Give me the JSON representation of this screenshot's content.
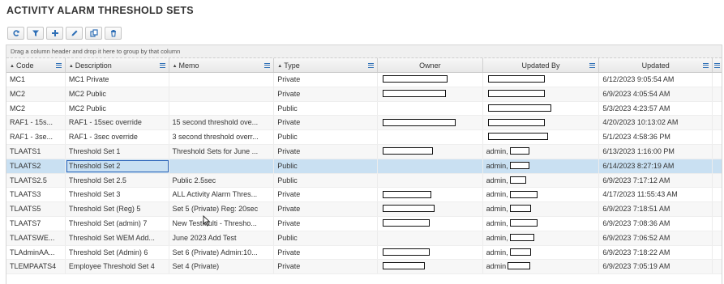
{
  "page": {
    "title": "ACTIVITY ALARM THRESHOLD SETS"
  },
  "toolbar": {
    "buttons": [
      {
        "name": "refresh-icon"
      },
      {
        "name": "filter-icon"
      },
      {
        "name": "add-icon"
      },
      {
        "name": "edit-icon"
      },
      {
        "name": "copy-icon"
      },
      {
        "name": "delete-icon"
      }
    ]
  },
  "grid": {
    "group_hint": "Drag a column header and drop it here to group by that column",
    "columns": [
      "Code",
      "Description",
      "Memo",
      "Type",
      "Owner",
      "Updated By",
      "Updated"
    ],
    "rows": [
      {
        "code": "MC1",
        "description": "MC1 Private",
        "memo": "",
        "type": "Private",
        "updated_by": "",
        "updated": "6/12/2023 9:05:54 AM"
      },
      {
        "code": "MC2",
        "description": "MC2 Public",
        "memo": "",
        "type": "Private",
        "updated_by": "",
        "updated": "6/9/2023 4:05:54 AM"
      },
      {
        "code": "MC2",
        "description": "MC2 Public",
        "memo": "",
        "type": "Public",
        "updated_by": "",
        "updated": "5/3/2023 4:23:57 AM"
      },
      {
        "code": "RAF1 - 15s...",
        "description": "RAF1 - 15sec override",
        "memo": "15 second threshold ove...",
        "type": "Private",
        "updated_by": "",
        "updated": "4/20/2023 10:13:02 AM"
      },
      {
        "code": "RAF1 - 3se...",
        "description": "RAF1 - 3sec override",
        "memo": "3 second threshold overr...",
        "type": "Public",
        "updated_by": "",
        "updated": "5/1/2023 4:58:36 PM"
      },
      {
        "code": "TLAATS1",
        "description": "Threshold Set 1",
        "memo": "Threshold Sets for June ...",
        "type": "Private",
        "updated_by": "admin,",
        "updated": "6/13/2023 1:16:00 PM"
      },
      {
        "code": "TLAATS2",
        "description": "Threshold Set 2",
        "memo": "",
        "type": "Public",
        "updated_by": "admin,",
        "updated": "6/14/2023 8:27:19 AM"
      },
      {
        "code": "TLAATS2.5",
        "description": "Threshold Set 2.5",
        "memo": "Public 2.5sec",
        "type": "Public",
        "updated_by": "admin,",
        "updated": "6/9/2023 7:17:12 AM"
      },
      {
        "code": "TLAATS3",
        "description": "Threshold Set 3",
        "memo": "ALL Activity Alarm Thres...",
        "type": "Private",
        "updated_by": "admin,",
        "updated": "4/17/2023 11:55:43 AM"
      },
      {
        "code": "TLAATS5",
        "description": "Threshold Set (Reg) 5",
        "memo": "Set 5 (Private) Reg: 20sec",
        "type": "Private",
        "updated_by": "admin,",
        "updated": "6/9/2023 7:18:51 AM"
      },
      {
        "code": "TLAATS7",
        "description": "Threshold Set (admin) 7",
        "memo": "New TestMulti - Thresho...",
        "type": "Private",
        "updated_by": "admin,",
        "updated": "6/9/2023 7:08:36 AM"
      },
      {
        "code": "TLAATSWE...",
        "description": "Threshold Set WEM Add...",
        "memo": "June 2023 Add Test",
        "type": "Public",
        "updated_by": "admin,",
        "updated": "6/9/2023 7:06:52 AM"
      },
      {
        "code": "TLAdminAA...",
        "description": "Threshold Set (Admin) 6",
        "memo": "Set 6 (Private) Admin:10...",
        "type": "Private",
        "updated_by": "admin,",
        "updated": "6/9/2023 7:18:22 AM"
      },
      {
        "code": "TLEMPAATS4",
        "description": "Employee Threshold Set 4",
        "memo": "Set 4 (Private)",
        "type": "Private",
        "updated_by": "admin",
        "updated": "6/9/2023 7:05:19 AM"
      }
    ]
  },
  "colors": {
    "selected_row": "#c9e0f2",
    "accent": "#2e6fb6"
  }
}
